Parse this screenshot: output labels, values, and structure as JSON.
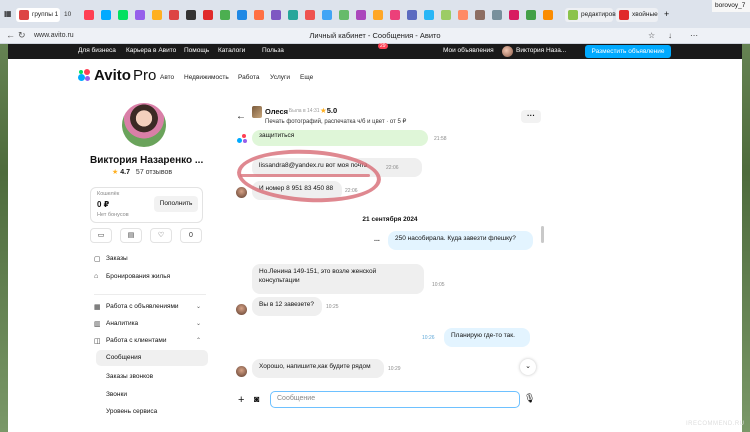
{
  "browser": {
    "tabs": [
      {
        "label": "группы 1"
      }
    ],
    "tab_count": "10",
    "url": "www.avito.ru",
    "page_title": "Личный кабинет - Сообщения - Авито",
    "right_tabs": [
      "редактировать",
      "хвойные"
    ],
    "yandex_user": "borovoy_7"
  },
  "topnav": {
    "links": [
      "Для бизнеса",
      "Карьера в Авито",
      "Помощь",
      "Каталоги",
      "Польза"
    ],
    "messages": "Мои объявления",
    "user": "Виктория Наза...",
    "notif_count": "29",
    "post_button": "Разместить объявление"
  },
  "brand": {
    "name": "Avito",
    "suffix": "Pro",
    "nav": [
      "Авто",
      "Недвижимость",
      "Работа",
      "Услуги",
      "Еще"
    ]
  },
  "profile": {
    "name": "Виктория Назаренко ...",
    "rating": "4.7",
    "reviews": "57 отзывов",
    "wallet_label": "Кошелёк",
    "wallet_sum": "0 ₽",
    "bonus": "Нет бонусов",
    "topup_button": "Пополнить",
    "icon_counter": "0"
  },
  "menu": {
    "orders": "Заказы",
    "bookings": "Бронирования жилья",
    "ads_work": "Работа с объявлениями",
    "analytics": "Аналитика",
    "clients": "Работа с клиентами",
    "messages": "Сообщения",
    "call_orders": "Заказы звонков",
    "calls": "Звонки",
    "service_level": "Уровень сервиса"
  },
  "chat": {
    "name": "Олеся",
    "meta": "Была в 14:31",
    "rating": "5.0",
    "subtitle": "Печать фотографий, распечатка ч/б и цвет · от 5 ₽",
    "messages": [
      {
        "text": "защититься",
        "time": "21:58"
      },
      {
        "text": "lissandra8@yandex.ru вот моя почта",
        "time": "22:06"
      },
      {
        "text": "И номер 8 951 83 450 88",
        "time": "22:06"
      },
      {
        "text": "250 насобирала. Куда завезти флешку?",
        "dots": "..."
      },
      {
        "text": "Но.Ленина 149-151, это возле женской консультации",
        "time": "10:05"
      },
      {
        "text": "Вы в 12 завезете?",
        "time": "10:25"
      },
      {
        "text": "Планирую где-то так.",
        "time": "10:26"
      },
      {
        "text": "Хорошо, напишите,как будите рядом",
        "time": "10:29"
      }
    ],
    "date_separator": "21 сентября 2024",
    "input_placeholder": "Сообщение"
  },
  "watermark": "IRECOMMEND.RU"
}
